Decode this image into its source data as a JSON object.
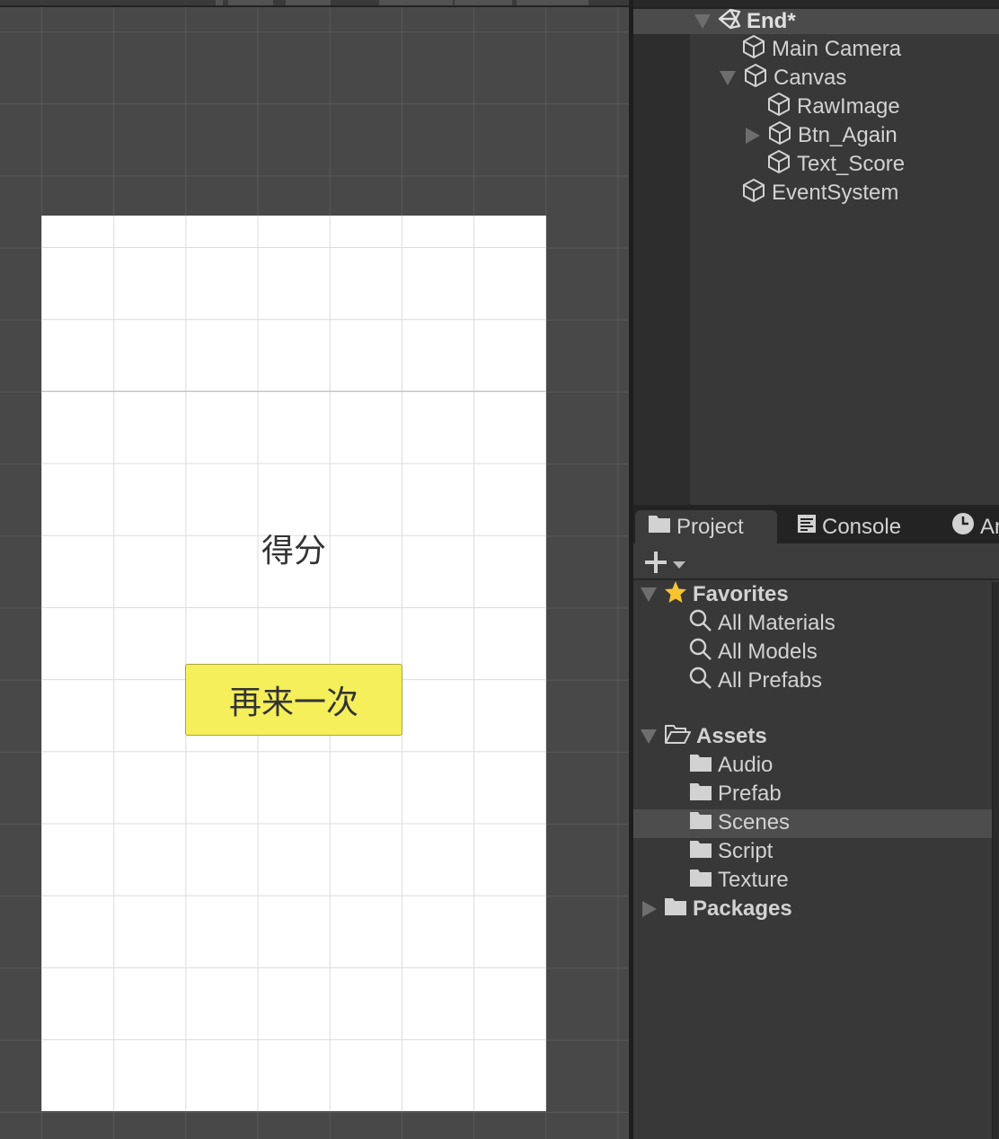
{
  "scene": {
    "score_label": "得分",
    "button_label": "再来一次",
    "button_color": "#f4ef5a",
    "canvas_color": "#ffffff"
  },
  "hierarchy": {
    "scene_name": "End*",
    "items": [
      {
        "label": "Main Camera",
        "icon": "cube-icon"
      },
      {
        "label": "Canvas",
        "icon": "cube-icon",
        "expanded": true
      },
      {
        "label": "RawImage",
        "icon": "cube-icon"
      },
      {
        "label": "Btn_Again",
        "icon": "cube-icon",
        "collapsed": true
      },
      {
        "label": "Text_Score",
        "icon": "cube-icon"
      },
      {
        "label": "EventSystem",
        "icon": "cube-icon"
      }
    ]
  },
  "project": {
    "tabs": [
      {
        "label": "Project",
        "icon": "folder-icon",
        "active": true
      },
      {
        "label": "Console",
        "icon": "console-icon"
      },
      {
        "label": "An",
        "icon": "clock-icon"
      }
    ],
    "favorites": {
      "label": "Favorites",
      "items": [
        "All Materials",
        "All Models",
        "All Prefabs"
      ]
    },
    "assets": {
      "label": "Assets",
      "items": [
        "Audio",
        "Prefab",
        "Scenes",
        "Script",
        "Texture"
      ],
      "selected": "Scenes"
    },
    "packages": {
      "label": "Packages"
    }
  }
}
